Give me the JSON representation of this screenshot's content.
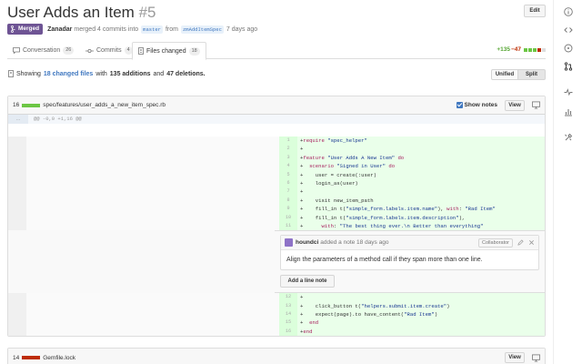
{
  "pr": {
    "title": "User Adds an Item",
    "number": "#5",
    "edit_label": "Edit",
    "state": "Merged",
    "author": "Zanadar",
    "merge_text": "merged 4 commits into",
    "base_branch": "master",
    "from_text": "from",
    "head_branch": "zmAddItemSpec",
    "time": "7 days ago"
  },
  "tabs": [
    {
      "label": "Conversation",
      "count": "26",
      "icon": "comment-icon"
    },
    {
      "label": "Commits",
      "count": "4",
      "icon": "commit-icon"
    },
    {
      "label": "Files changed",
      "count": "18",
      "icon": "file-diff-icon"
    }
  ],
  "diffstat": {
    "additions": "+135",
    "deletions": "−47"
  },
  "toc": {
    "prefix": "Showing",
    "files": "18 changed files",
    "with": "with",
    "additions": "135 additions",
    "and": "and",
    "deletions": "47 deletions."
  },
  "view_mode": {
    "unified": "Unified",
    "split": "Split"
  },
  "file1": {
    "count": "16",
    "path": "spec/features/user_adds_a_new_item_spec.rb",
    "show_notes": "Show notes",
    "view": "View",
    "hunk_gutter": "...",
    "hunk": "@@ -0,0 +1,16 @@",
    "lines_a": [
      {
        "n": "1",
        "code": "+require \"spec_helper\""
      },
      {
        "n": "2",
        "code": "+"
      },
      {
        "n": "3",
        "code": "+feature \"User Adds A New Item\" do"
      },
      {
        "n": "4",
        "code": "+  scenario \"Signed in User\" do"
      },
      {
        "n": "5",
        "code": "+    user = create(:user)"
      },
      {
        "n": "6",
        "code": "+    login_as(user)"
      },
      {
        "n": "7",
        "code": "+"
      },
      {
        "n": "8",
        "code": "+    visit new_item_path"
      },
      {
        "n": "9",
        "code": "+    fill_in t(\"simple_form.labels.item.name\"), with: \"Rad Item\""
      },
      {
        "n": "10",
        "code": "+    fill_in t(\"simple_form.labels.item.description\"),"
      },
      {
        "n": "11",
        "code": "+      with: \"The best thing ever.\\n Better than everything\""
      }
    ],
    "comment": {
      "author": "houndci",
      "meta": "added a note 18 days ago",
      "role": "Collaborator",
      "body": "Align the parameters of a method call if they span more than one line.",
      "add_note": "Add a line note"
    },
    "lines_b": [
      {
        "n": "12",
        "code": "+"
      },
      {
        "n": "13",
        "code": "+    click_button t(\"helpers.submit.item.create\")"
      },
      {
        "n": "14",
        "code": "+    expect(page).to have_content(\"Rad Item\")"
      },
      {
        "n": "15",
        "code": "+  end"
      },
      {
        "n": "16",
        "code": "+end"
      }
    ]
  },
  "file2": {
    "count": "14",
    "path": "Gemfile.lock",
    "view": "View"
  },
  "colors": {
    "merged": "#6e5494",
    "addition_bg": "#eaffea",
    "link": "#4078c0",
    "add_green": "#6cc644",
    "del_red": "#bd2c00"
  },
  "sidebar_icons": [
    "info-icon",
    "code-icon",
    "issue-icon",
    "pull-request-icon",
    "wiki-icon",
    "pulse-icon",
    "graph-icon",
    "settings-icon"
  ]
}
